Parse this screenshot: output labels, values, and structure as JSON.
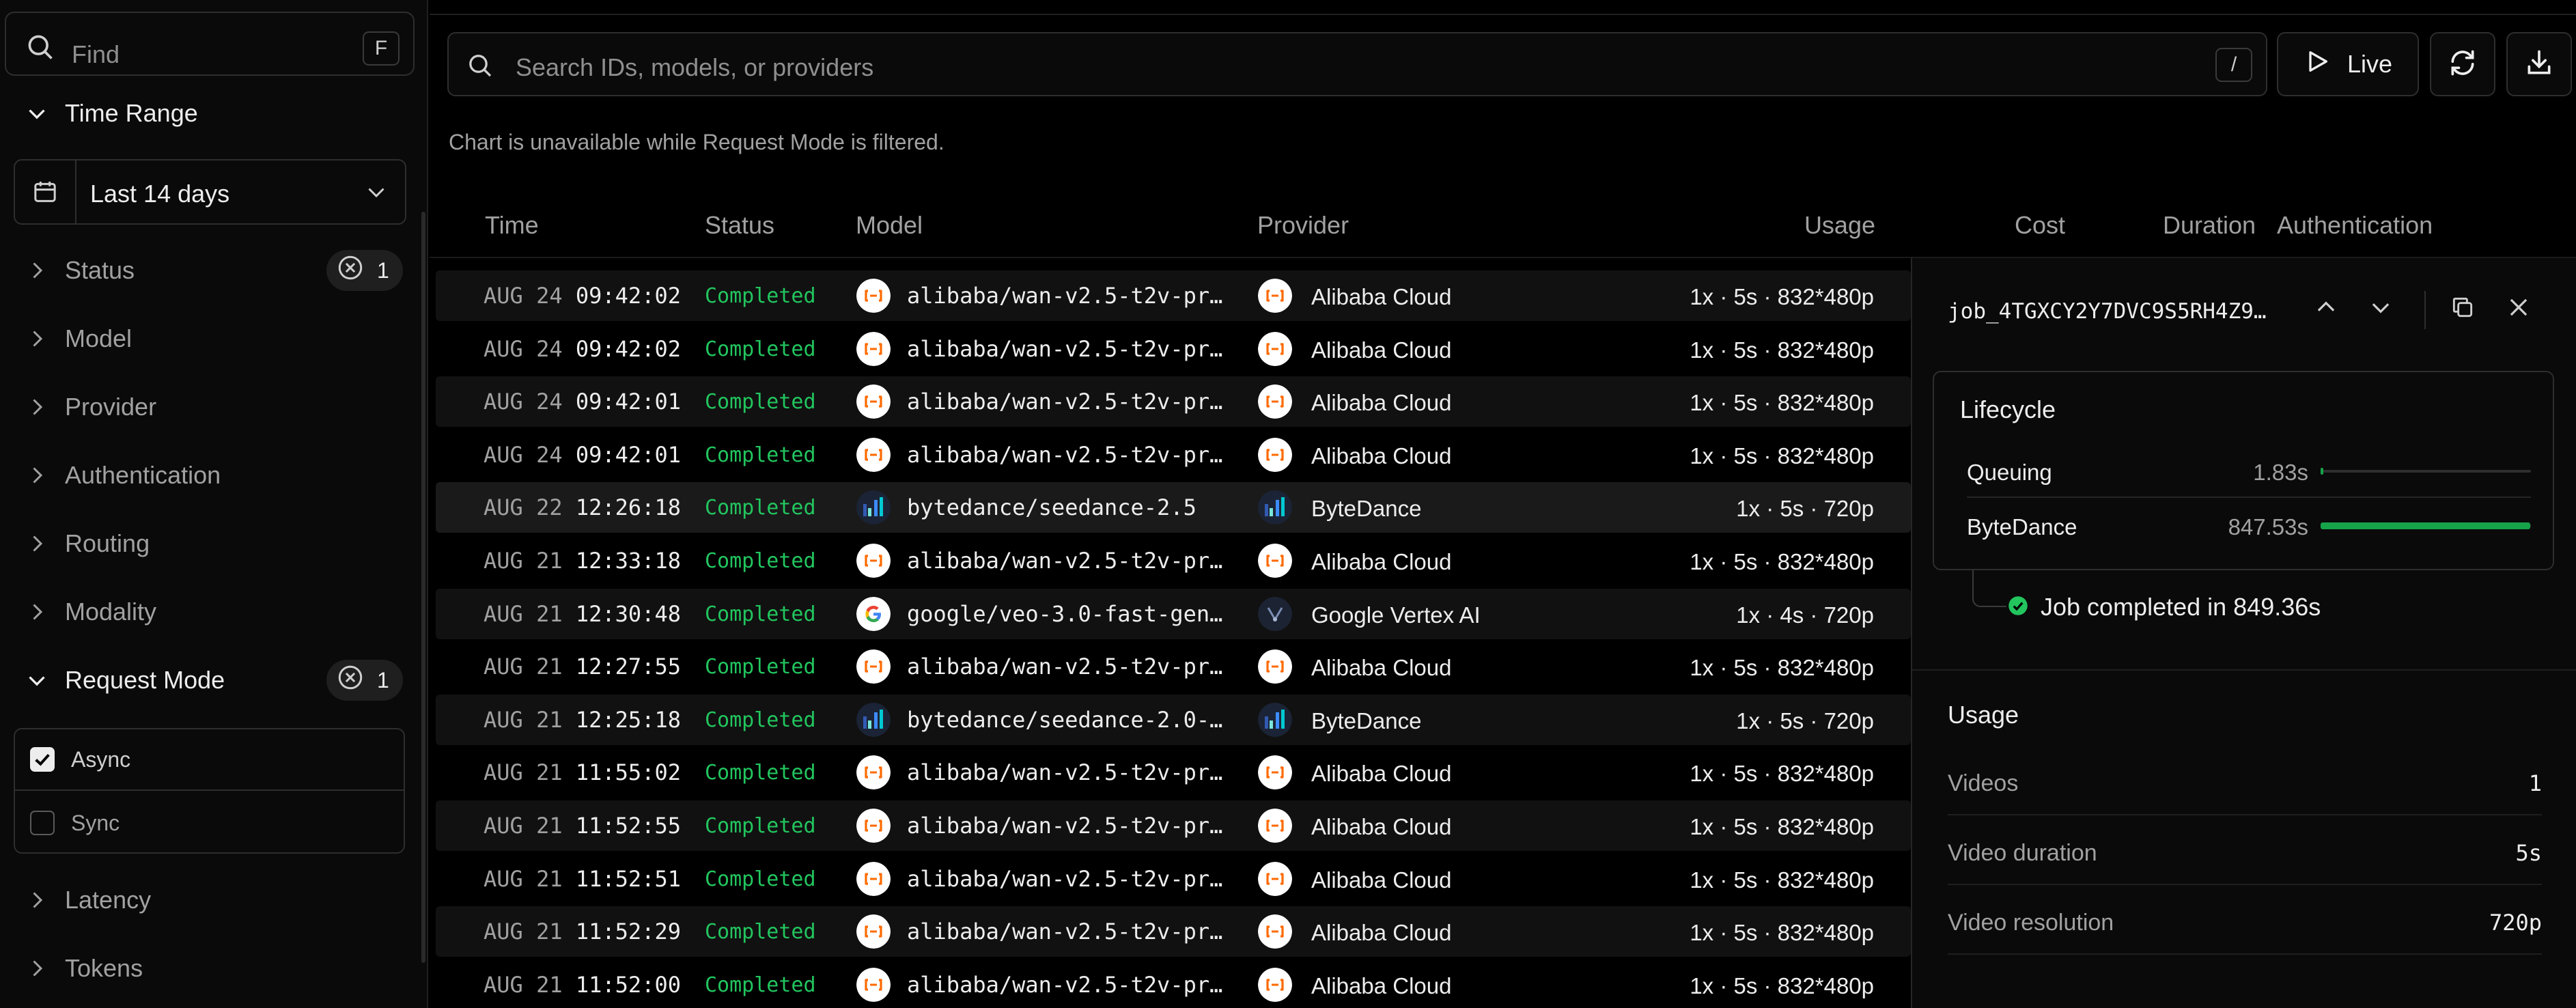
{
  "sidebar": {
    "find_placeholder": "Find",
    "find_shortcut": "F",
    "time_range": {
      "label": "Time Range",
      "value": "Last 14 days"
    },
    "filters": [
      {
        "label": "Status",
        "count": "1"
      },
      {
        "label": "Model"
      },
      {
        "label": "Provider"
      },
      {
        "label": "Authentication"
      },
      {
        "label": "Routing"
      },
      {
        "label": "Modality"
      }
    ],
    "request_mode": {
      "label": "Request Mode",
      "count": "1",
      "options": [
        {
          "label": "Async",
          "checked": true
        },
        {
          "label": "Sync",
          "checked": false
        }
      ]
    },
    "more_filters": [
      {
        "label": "Latency"
      },
      {
        "label": "Tokens"
      }
    ]
  },
  "toolbar": {
    "search_placeholder": "Search IDs, models, or providers",
    "search_shortcut": "/",
    "live_label": "Live"
  },
  "notice": "Chart is unavailable while Request Mode is filtered.",
  "table": {
    "columns": [
      "Time",
      "Status",
      "Model",
      "Provider",
      "Usage",
      "Cost",
      "Duration",
      "Authentication"
    ],
    "rows": [
      {
        "date": "AUG 24",
        "time": "09:42:02",
        "status": "Completed",
        "model": "alibaba/wan-v2.5-t2v-pr…",
        "model_icon": "alibaba",
        "provider": "Alibaba Cloud",
        "provider_icon": "alibaba",
        "usage": "1x · 5s · 832*480p"
      },
      {
        "date": "AUG 24",
        "time": "09:42:02",
        "status": "Completed",
        "model": "alibaba/wan-v2.5-t2v-pr…",
        "model_icon": "alibaba",
        "provider": "Alibaba Cloud",
        "provider_icon": "alibaba",
        "usage": "1x · 5s · 832*480p"
      },
      {
        "date": "AUG 24",
        "time": "09:42:01",
        "status": "Completed",
        "model": "alibaba/wan-v2.5-t2v-pr…",
        "model_icon": "alibaba",
        "provider": "Alibaba Cloud",
        "provider_icon": "alibaba",
        "usage": "1x · 5s · 832*480p"
      },
      {
        "date": "AUG 24",
        "time": "09:42:01",
        "status": "Completed",
        "model": "alibaba/wan-v2.5-t2v-pr…",
        "model_icon": "alibaba",
        "provider": "Alibaba Cloud",
        "provider_icon": "alibaba",
        "usage": "1x · 5s · 832*480p"
      },
      {
        "date": "AUG 22",
        "time": "12:26:18",
        "status": "Completed",
        "model": "bytedance/seedance-2.5",
        "model_icon": "bytedance",
        "provider": "ByteDance",
        "provider_icon": "bytedance",
        "usage": "1x · 5s · 720p",
        "selected": true
      },
      {
        "date": "AUG 21",
        "time": "12:33:18",
        "status": "Completed",
        "model": "alibaba/wan-v2.5-t2v-pr…",
        "model_icon": "alibaba",
        "provider": "Alibaba Cloud",
        "provider_icon": "alibaba",
        "usage": "1x · 5s · 832*480p"
      },
      {
        "date": "AUG 21",
        "time": "12:30:48",
        "status": "Completed",
        "model": "google/veo-3.0-fast-gen…",
        "model_icon": "google",
        "provider": "Google Vertex AI",
        "provider_icon": "vertex",
        "usage": "1x · 4s · 720p"
      },
      {
        "date": "AUG 21",
        "time": "12:27:55",
        "status": "Completed",
        "model": "alibaba/wan-v2.5-t2v-pr…",
        "model_icon": "alibaba",
        "provider": "Alibaba Cloud",
        "provider_icon": "alibaba",
        "usage": "1x · 5s · 832*480p"
      },
      {
        "date": "AUG 21",
        "time": "12:25:18",
        "status": "Completed",
        "model": "bytedance/seedance-2.0-…",
        "model_icon": "bytedance",
        "provider": "ByteDance",
        "provider_icon": "bytedance",
        "usage": "1x · 5s · 720p"
      },
      {
        "date": "AUG 21",
        "time": "11:55:02",
        "status": "Completed",
        "model": "alibaba/wan-v2.5-t2v-pr…",
        "model_icon": "alibaba",
        "provider": "Alibaba Cloud",
        "provider_icon": "alibaba",
        "usage": "1x · 5s · 832*480p"
      },
      {
        "date": "AUG 21",
        "time": "11:52:55",
        "status": "Completed",
        "model": "alibaba/wan-v2.5-t2v-pr…",
        "model_icon": "alibaba",
        "provider": "Alibaba Cloud",
        "provider_icon": "alibaba",
        "usage": "1x · 5s · 832*480p"
      },
      {
        "date": "AUG 21",
        "time": "11:52:51",
        "status": "Completed",
        "model": "alibaba/wan-v2.5-t2v-pr…",
        "model_icon": "alibaba",
        "provider": "Alibaba Cloud",
        "provider_icon": "alibaba",
        "usage": "1x · 5s · 832*480p"
      },
      {
        "date": "AUG 21",
        "time": "11:52:29",
        "status": "Completed",
        "model": "alibaba/wan-v2.5-t2v-pr…",
        "model_icon": "alibaba",
        "provider": "Alibaba Cloud",
        "provider_icon": "alibaba",
        "usage": "1x · 5s · 832*480p"
      },
      {
        "date": "AUG 21",
        "time": "11:52:00",
        "status": "Completed",
        "model": "alibaba/wan-v2.5-t2v-pr…",
        "model_icon": "alibaba",
        "provider": "Alibaba Cloud",
        "provider_icon": "alibaba",
        "usage": "1x · 5s · 832*480p"
      }
    ]
  },
  "detail": {
    "job_id": "job_4TGXCY2Y7DVC9S5RH4Z9…",
    "lifecycle": {
      "title": "Lifecycle",
      "stages": [
        {
          "name": "Queuing",
          "value": "1.83s",
          "fraction": 0.002
        },
        {
          "name": "ByteDance",
          "value": "847.53s",
          "fraction": 0.998
        }
      ],
      "completed_text": "Job completed in 849.36s"
    },
    "usage": {
      "title": "Usage",
      "rows": [
        {
          "key": "Videos",
          "value": "1"
        },
        {
          "key": "Video duration",
          "value": "5s"
        },
        {
          "key": "Video resolution",
          "value": "720p"
        }
      ]
    }
  },
  "colors": {
    "status_completed": "#22c55e",
    "progress_fill": "#16a34a",
    "alibaba_orange": "#ff6a00"
  }
}
